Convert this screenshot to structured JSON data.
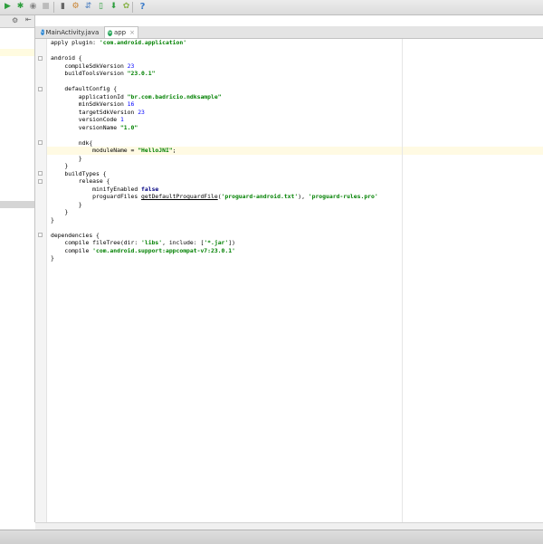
{
  "toolbar": {
    "buttons": [
      {
        "icon": "run-icon",
        "glyph": "▶",
        "color": "#2e9e3e"
      },
      {
        "icon": "debug-icon",
        "glyph": "✱",
        "color": "#2e9e3e"
      },
      {
        "icon": "attach-debugger-icon",
        "glyph": "◉",
        "color": "#888888"
      },
      {
        "icon": "stop-icon",
        "glyph": "■",
        "color": "#bbbbbb"
      },
      {
        "icon": "device-icon",
        "glyph": "▮",
        "color": "#666666"
      },
      {
        "icon": "project-structure-icon",
        "glyph": "⚙",
        "color": "#c9822e"
      },
      {
        "icon": "sync-icon",
        "glyph": "⇵",
        "color": "#4a7dbf"
      },
      {
        "icon": "avd-manager-icon",
        "glyph": "▯",
        "color": "#2e9e3e"
      },
      {
        "icon": "sdk-manager-icon",
        "glyph": "⬇",
        "color": "#2e9e3e"
      },
      {
        "icon": "android-monitor-icon",
        "glyph": "✿",
        "color": "#8ab34a"
      },
      {
        "icon": "help-icon",
        "glyph": "?",
        "color": "#3d7cc9"
      }
    ]
  },
  "tabs": [
    {
      "label": "MainActivity.java",
      "icon": "java-class-icon",
      "icon_letter": "C",
      "icon_color": "#3b8fd6",
      "active": false
    },
    {
      "label": "app",
      "icon": "gradle-icon",
      "icon_letter": "G",
      "icon_color": "#27a65a",
      "active": true
    }
  ],
  "code_lines": [
    [
      {
        "t": "apply plugin: "
      },
      {
        "t": "'com.android.application'",
        "c": "str"
      }
    ],
    [],
    [
      {
        "t": "android {"
      }
    ],
    [
      {
        "t": "    compileSdkVersion "
      },
      {
        "t": "23",
        "c": "num"
      }
    ],
    [
      {
        "t": "    buildToolsVersion "
      },
      {
        "t": "\"23.0.1\"",
        "c": "str"
      }
    ],
    [],
    [
      {
        "t": "    defaultConfig {"
      }
    ],
    [
      {
        "t": "        applicationId "
      },
      {
        "t": "\"br.com.badricio.ndksample\"",
        "c": "str"
      }
    ],
    [
      {
        "t": "        minSdkVersion "
      },
      {
        "t": "16",
        "c": "num"
      }
    ],
    [
      {
        "t": "        targetSdkVersion "
      },
      {
        "t": "23",
        "c": "num"
      }
    ],
    [
      {
        "t": "        versionCode "
      },
      {
        "t": "1",
        "c": "num"
      }
    ],
    [
      {
        "t": "        versionName "
      },
      {
        "t": "\"1.0\"",
        "c": "str"
      }
    ],
    [],
    [
      {
        "t": "        ndk{"
      }
    ],
    [
      {
        "t": "            moduleName = "
      },
      {
        "t": "\"HelloJNI\"",
        "c": "str"
      },
      {
        "t": ";"
      }
    ],
    [
      {
        "t": "        }"
      }
    ],
    [
      {
        "t": "    }"
      }
    ],
    [
      {
        "t": "    buildTypes {"
      }
    ],
    [
      {
        "t": "        release {"
      }
    ],
    [
      {
        "t": "            minifyEnabled "
      },
      {
        "t": "false",
        "c": "kw"
      }
    ],
    [
      {
        "t": "            proguardFiles "
      },
      {
        "t": "getDefaultProguardFile",
        "c": "fn"
      },
      {
        "t": "("
      },
      {
        "t": "'proguard-android.txt'",
        "c": "str"
      },
      {
        "t": "), "
      },
      {
        "t": "'proguard-rules.pro'",
        "c": "str"
      }
    ],
    [
      {
        "t": "        }"
      }
    ],
    [
      {
        "t": "    }"
      }
    ],
    [
      {
        "t": "}"
      }
    ],
    [],
    [
      {
        "t": "dependencies {"
      }
    ],
    [
      {
        "t": "    compile fileTree(dir: "
      },
      {
        "t": "'libs'",
        "c": "str"
      },
      {
        "t": ", include: ["
      },
      {
        "t": "'*.jar'",
        "c": "str"
      },
      {
        "t": "])"
      }
    ],
    [
      {
        "t": "    compile "
      },
      {
        "t": "'com.android.support:appcompat-v7:23.0.1'",
        "c": "str"
      }
    ],
    [
      {
        "t": "}"
      }
    ]
  ],
  "caret_line": 14,
  "fold_lines": [
    2,
    6,
    13,
    17,
    18,
    25
  ]
}
